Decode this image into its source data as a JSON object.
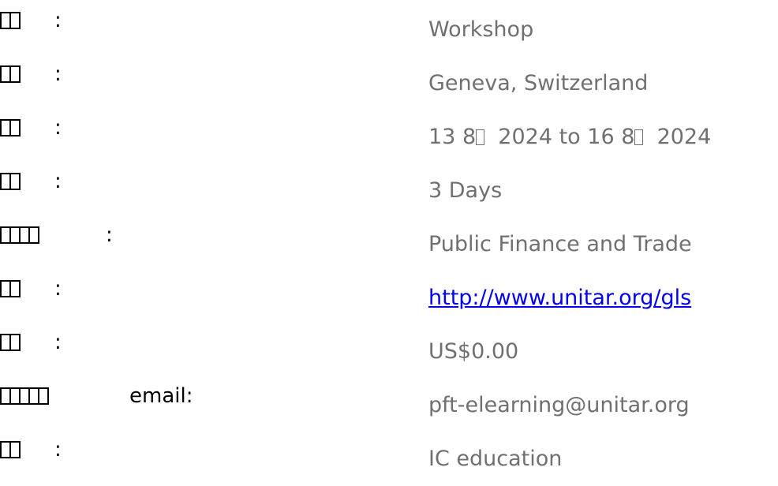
{
  "fields": [
    {
      "label_glyphs": 2,
      "colon": ":",
      "value": "Workshop"
    },
    {
      "label_glyphs": 2,
      "colon": ":",
      "value": "Geneva, Switzerland"
    },
    {
      "label_glyphs": 2,
      "colon": ":",
      "value_parts": [
        "13 8",
        "2024 to 16 8",
        "2024"
      ]
    },
    {
      "label_glyphs": 2,
      "colon": ":",
      "value": "3 Days"
    },
    {
      "label_glyphs": 4,
      "colon": ":",
      "value": "Public Finance and Trade"
    },
    {
      "label_glyphs": 2,
      "colon": ":",
      "value": "http://www.unitar.org/gls",
      "is_link": true
    },
    {
      "label_glyphs": 2,
      "colon": ":",
      "value": "US$0.00"
    },
    {
      "label_glyphs": 5,
      "colon": "email:",
      "value": "pft-elearning@unitar.org"
    },
    {
      "label_glyphs": 2,
      "colon": ":",
      "value": "IC education"
    }
  ],
  "colors": {
    "label": "#000000",
    "value": "#707070",
    "link": "#0000ee",
    "background": "#ffffff"
  }
}
